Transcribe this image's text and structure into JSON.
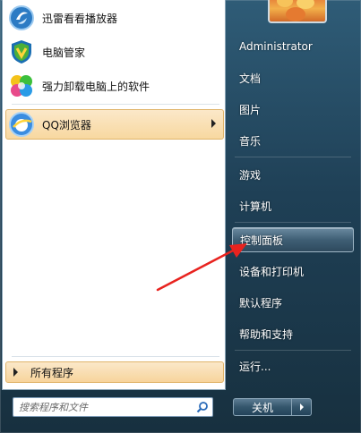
{
  "pinned_programs": [
    {
      "label": "迅雷看看播放器",
      "icon": "xunlei-player-icon"
    },
    {
      "label": "电脑管家",
      "icon": "pc-manager-shield-icon"
    },
    {
      "label": "强力卸载电脑上的软件",
      "icon": "uninstaller-icon"
    }
  ],
  "recent_programs": [
    {
      "label": "QQ浏览器",
      "icon": "qq-browser-icon",
      "has_submenu": true
    }
  ],
  "all_programs_label": "所有程序",
  "search": {
    "placeholder": "搜索程序和文件"
  },
  "user": {
    "name": "Administrator"
  },
  "right_items": [
    {
      "label": "文档"
    },
    {
      "label": "图片"
    },
    {
      "label": "音乐"
    },
    {
      "label": "游戏"
    },
    {
      "label": "计算机"
    },
    {
      "label": "控制面板",
      "selected": true
    },
    {
      "label": "设备和打印机"
    },
    {
      "label": "默认程序"
    },
    {
      "label": "帮助和支持"
    },
    {
      "label": "运行..."
    }
  ],
  "shutdown_label": "关机",
  "colors": {
    "highlight": "#f8d8a0",
    "annotation_arrow": "#e8231f"
  }
}
